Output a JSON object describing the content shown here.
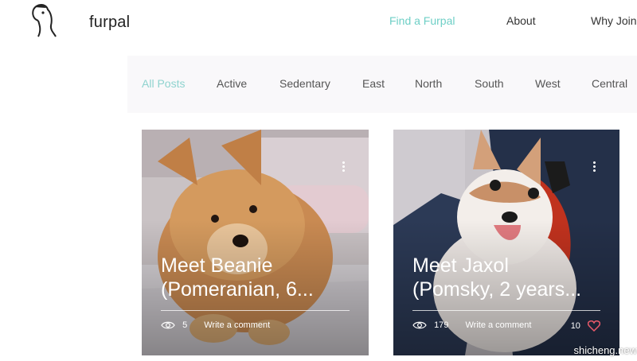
{
  "header": {
    "logo_text": "furpal",
    "nav": [
      "Find a Furpal",
      "About",
      "Why Join?"
    ]
  },
  "categories": [
    "All Posts",
    "Active",
    "Sedentary",
    "East",
    "North",
    "South",
    "West",
    "Central"
  ],
  "posts": [
    {
      "title_line1": "Meet Beanie",
      "title_line2": "(Pomeranian, 6...",
      "views": "5",
      "comment_label": "Write a comment",
      "likes": ""
    },
    {
      "title_line1": "Meet Jaxol",
      "title_line2": "(Pomsky, 2 years...",
      "views": "179",
      "comment_label": "Write a comment",
      "likes": "10"
    }
  ],
  "watermark": "shicheng.new",
  "colors": {
    "accent": "#6ecfc6",
    "heart": "#e85a6a"
  }
}
